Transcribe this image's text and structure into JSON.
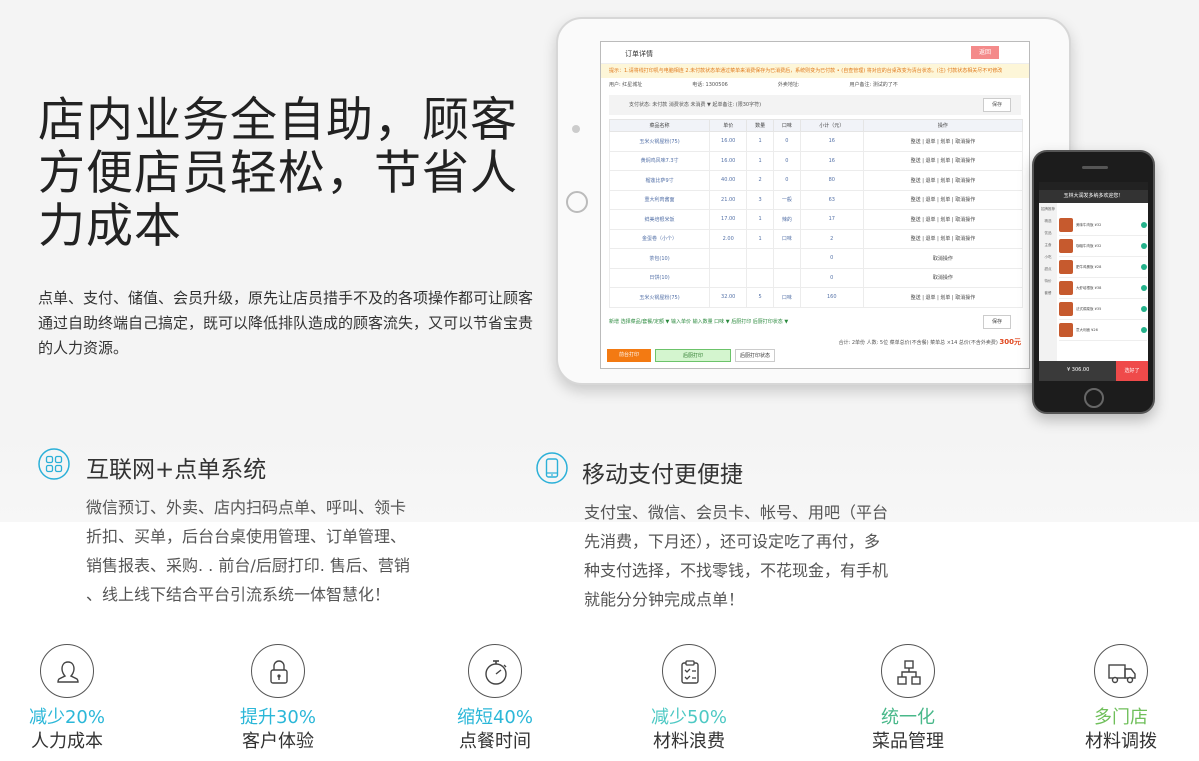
{
  "hero": {
    "title": "店内业务全自助，顾客方便店员轻松，节省人力成本",
    "description": "点单、支付、储值、会员升级，原先让店员措手不及的各项操作都可让顾客通过自助终端自己搞定，既可以降低排队造成的顾客流失，又可以节省宝贵的人力资源。"
  },
  "tablet_screen": {
    "title": "订单详情",
    "back_label": "返回",
    "tip": "提示：1.请将线打印机与电脑相连 2.未付款状态单通过菜单来消费保存为已消费后，系统则变为已付款 • (自查管理) 将对应的台桌改变为清台状态。(注) 付款状态相关尽不可修改",
    "info": [
      "用户: 红星城址",
      "电话: 1300506",
      "外卖地址:",
      "用户备注: 测试的了不"
    ],
    "filter": "支付状态: 未付款    消费状态 未消费 ▼    起单备注:                        (限30字符)",
    "save_label": "保存",
    "columns": [
      "菜品名称",
      "单价",
      "数量",
      "口味",
      "小计（元）",
      "操作"
    ],
    "rows": [
      [
        "玉米火锅屋粉(75)",
        "16.00",
        "1",
        "0",
        "16",
        "整送 | 退单 | 划单 | 取消操作"
      ],
      [
        "黄焖鸡风味7.3寸",
        "16.00",
        "1",
        "0",
        "16",
        "整送 | 退单 | 划单 | 取消操作"
      ],
      [
        "榴莲比萨9寸",
        "40.00",
        "2",
        "0",
        "80",
        "整送 | 退单 | 划单 | 取消操作"
      ],
      [
        "重大利肉酱面",
        "21.00",
        "3",
        "一般",
        "63",
        "整送 | 退单 | 划单 | 取消操作"
      ],
      [
        "鲜美培根米饭",
        "17.00",
        "1",
        "辣的",
        "17",
        "整送 | 退单 | 划单 | 取消操作"
      ],
      [
        "金蛋卷（小个）",
        "2.00",
        "1",
        "口味",
        "2",
        "整送 | 退单 | 划单 | 取消操作"
      ],
      [
        "茶包(10)",
        "",
        "",
        "",
        "0",
        "取消操作"
      ],
      [
        "日饼(10)",
        "",
        "",
        "",
        "0",
        "取消操作"
      ],
      [
        "玉米火锅屋粉(75)",
        "32.00",
        "5",
        "口味",
        "160",
        "整送 | 退单 | 划单 | 取消操作"
      ]
    ],
    "add_row": "新增  选择菜品/套餐/定额 ▼    输入单价        输入数量        口味 ▼    后厨打印  后厨打印状态 ▼",
    "summary": "合计: 2单份   人数: 5位   菜单总价(不含餐) 菜单总 ×14   总价(不含外卖费)",
    "total": "300元",
    "footer": [
      "前台打印",
      "后厨打印",
      "后厨打印状态"
    ]
  },
  "phone_screen": {
    "title": "玉林大润发多纳多欢迎您！",
    "side": [
      "招牌推荐",
      "精选",
      "饮品",
      "主食",
      "小吃",
      "甜点",
      "特价",
      "套餐"
    ],
    "items": [
      "美味牛肉饭 ¥32",
      "咖喱牛肉饭 ¥32",
      "肥牛鸡蛋饭 ¥28",
      "大虾培根饭 ¥38",
      "法式焗菜饭 ¥35",
      "意大利面 ¥26"
    ],
    "price": "¥ 306.00",
    "order_label": "选好了"
  },
  "features": [
    {
      "icon": "grid-icon",
      "title": "互联网+点单系统",
      "lines": [
        "微信预订、外卖、店内扫码点单、呼叫、领卡",
        "折扣、买单，后台台桌使用管理、订单管理、",
        "销售报表、采购. . 前台/后厨打印. 售后、营销",
        "、线上线下结合平台引流系统一体智慧化！"
      ]
    },
    {
      "icon": "mobile-icon",
      "title": "移动支付更便捷",
      "lines": [
        "支付宝、微信、会员卡、帐号、用吧（平台",
        "先消费，下月还），还可设定吃了再付，多",
        "种支付选择，不找零钱，不花现金，有手机",
        "就能分分钟完成点单！"
      ]
    }
  ],
  "stats": [
    {
      "icon": "user-icon",
      "value": "减少20%",
      "label": "人力成本",
      "color": "#2bb7d8"
    },
    {
      "icon": "lock-icon",
      "value": "提升30%",
      "label": "客户体验",
      "color": "#2bb7d8"
    },
    {
      "icon": "stopwatch-icon",
      "value": "缩短40%",
      "label": "点餐时间",
      "color": "#2bb7d8"
    },
    {
      "icon": "checklist-icon",
      "value": "减少50%",
      "label": "材料浪费",
      "color": "#4ec9c4"
    },
    {
      "icon": "hierarchy-icon",
      "value": "统一化",
      "label": "菜品管理",
      "color": "#49b88a"
    },
    {
      "icon": "truck-icon",
      "value": "多门店",
      "label": "材料调拨",
      "color": "#6fbf5a"
    }
  ]
}
